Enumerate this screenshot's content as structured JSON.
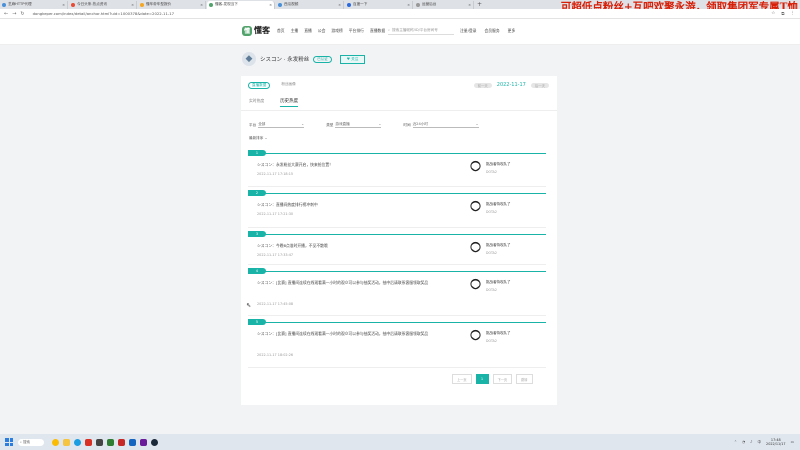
{
  "browser": {
    "tabs": [
      {
        "label": "芝麻HTTP代理",
        "active": false
      },
      {
        "label": "今日头条-热点资讯",
        "active": false
      },
      {
        "label": "懂车帝车型报价",
        "active": false
      },
      {
        "label": "懂客-发现当下",
        "active": true
      },
      {
        "label": "西瓜视频",
        "active": false
      },
      {
        "label": "百度一下",
        "active": false
      },
      {
        "label": "运营后台",
        "active": false
      },
      {
        "label": "新标签页",
        "active": false
      }
    ],
    "new_tab": "+",
    "url": "dongkeper.com/index/detail/anchor.html?uid=1000378&date=2022-11-17",
    "banner": "可超低点粉丝+互吧欢聚永游，领取集团军专属T恤"
  },
  "site": {
    "logo_mark": "懂",
    "logo_text": "懂客",
    "nav": [
      "首页",
      "主播",
      "直播",
      "公会",
      "游戏榜",
      "平台排行",
      "直播数据"
    ],
    "search_placeholder": "搜索主播昵称/ID/平台房间号",
    "user_nav": [
      "注册/登录",
      "会员服务",
      "更多"
    ]
  },
  "profile": {
    "name": "シスコン · 永发粉丝",
    "badge": "已认证",
    "follow": "关注"
  },
  "card": {
    "top_tabs": [
      "直播数据",
      "粉丝画像"
    ],
    "prev_day": "前一天",
    "date": "2022-11-17",
    "next_day": "后一天",
    "sub_tabs": [
      "实时热度",
      "历史热度"
    ],
    "filters": [
      {
        "label": "平台",
        "value": "全部"
      },
      {
        "label": "类型",
        "value": "游戏直播"
      },
      {
        "label": "时间",
        "value": "近24小时"
      }
    ],
    "sort": "最新排序"
  },
  "items": [
    {
      "num": "1",
      "title": "シスコン：永发粉丝大赛开启，快来抢位置！",
      "time": "2022-11-17 17:18:15",
      "user": "挑战者特攻队了",
      "sub": "DOTA2"
    },
    {
      "num": "2",
      "title": "シスコン：直播间热度排行榜冲刺中",
      "time": "2022-11-17 17:21:30",
      "user": "挑战者特攻队了",
      "sub": "DOTA2"
    },
    {
      "num": "3",
      "title": "シスコン：今晚8点准时开播，不见不散哦",
      "time": "2022-11-17 17:33:47",
      "user": "挑战者特攻队了",
      "sub": "DOTA2"
    },
    {
      "num": "4",
      "title": "シスコン：[比赛] 直播间连续在线观看满一小时的观众可以参与抽奖活动，抽中后请联系客服领取奖品",
      "time": "2022-11-17 17:45:08",
      "user": "挑战者特攻队了",
      "sub": "DOTA2"
    },
    {
      "num": "5",
      "title": "シスコン：[比赛] 直播间连续在线观看满一小时的观众可以参与抽奖活动，抽中后请联系客服领取奖品",
      "time": "2022-11-17 18:02:26",
      "user": "挑战者特攻队了",
      "sub": "DOTA2"
    }
  ],
  "pagination": {
    "prev": "上一页",
    "current": "1",
    "next": "下一页",
    "jump": "跳转"
  },
  "taskbar": {
    "search_label": "搜索",
    "time": "17:48",
    "date": "2022/11/17",
    "lang": "中"
  }
}
